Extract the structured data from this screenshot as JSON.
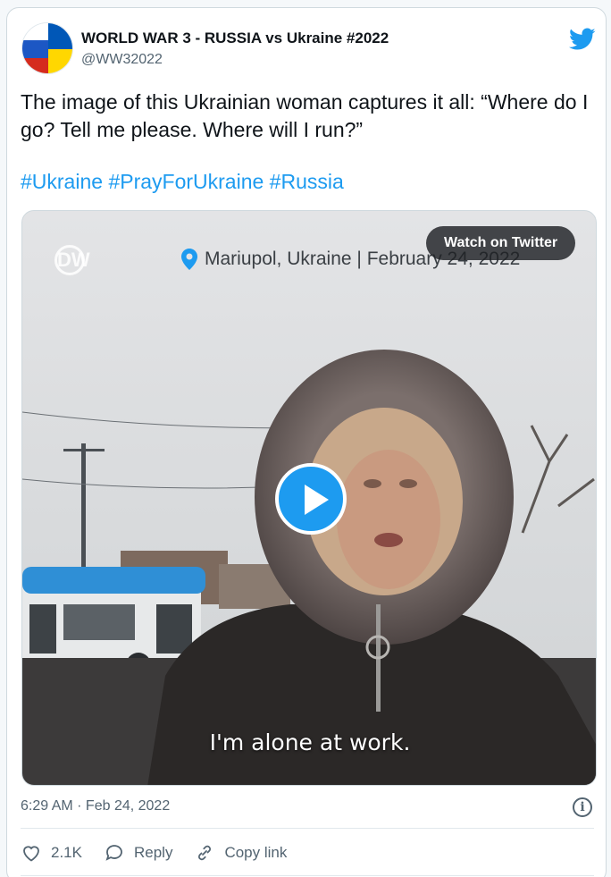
{
  "tweet": {
    "author_name": "WORLD WAR 3 - RUSSIA vs Ukraine #2022",
    "author_handle": "@WW32022",
    "text": "The image of this Ukrainian woman captures it all: “Where do I go? Tell me please. Where will I run?”",
    "hashtags": [
      "#Ukraine",
      "#PrayForUkraine",
      "#Russia"
    ],
    "timestamp": "6:29 AM · Feb 24, 2022"
  },
  "media": {
    "watermark": "DW",
    "location_caption": "Mariupol, Ukraine | February 24, 2022",
    "watch_label": "Watch on Twitter",
    "subtitle": "I'm alone at work."
  },
  "actions": {
    "likes": "2.1K",
    "reply_label": "Reply",
    "copy_label": "Copy link"
  },
  "icons": {
    "brand": "twitter-bird-icon",
    "like": "heart-icon",
    "reply": "speech-bubble-icon",
    "copy": "link-icon",
    "info": "info-icon",
    "location": "location-pin-icon"
  },
  "colors": {
    "twitter_blue": "#1d9bf0",
    "text": "#0f1419",
    "secondary_text": "#536471"
  }
}
